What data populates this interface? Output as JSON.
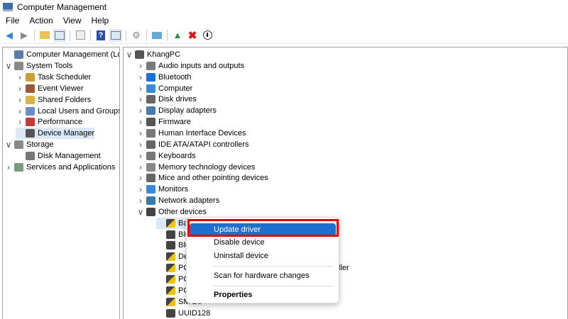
{
  "window": {
    "title": "Computer Management"
  },
  "menu": [
    "File",
    "Action",
    "View",
    "Help"
  ],
  "toolbar": [
    "back-icon",
    "forward-icon",
    "up-folder-icon",
    "show-hide-tree-icon",
    "properties-icon",
    "help-icon",
    "show-action-pane-icon",
    "update-driver-icon",
    "scan-hardware-icon",
    "enable-device-icon",
    "uninstall-icon",
    "disable-device-icon"
  ],
  "left_tree": [
    {
      "label": "Computer Management (Local",
      "level": 0,
      "chev": "",
      "color": "#5a7ea8"
    },
    {
      "label": "System Tools",
      "level": 0,
      "chev": "v",
      "color": "#8a8a8a"
    },
    {
      "label": "Task Scheduler",
      "level": 1,
      "chev": ">",
      "color": "#c9a13b"
    },
    {
      "label": "Event Viewer",
      "level": 1,
      "chev": ">",
      "color": "#9c5a3c"
    },
    {
      "label": "Shared Folders",
      "level": 1,
      "chev": ">",
      "color": "#d9b44a"
    },
    {
      "label": "Local Users and Groups",
      "level": 1,
      "chev": ">",
      "color": "#6b8fc0"
    },
    {
      "label": "Performance",
      "level": 1,
      "chev": ">",
      "color": "#c23b3b"
    },
    {
      "label": "Device Manager",
      "level": 1,
      "chev": "",
      "color": "#555",
      "selected": true
    },
    {
      "label": "Storage",
      "level": 0,
      "chev": "v",
      "color": "#8a8a8a"
    },
    {
      "label": "Disk Management",
      "level": 1,
      "chev": "",
      "color": "#777"
    },
    {
      "label": "Services and Applications",
      "level": 0,
      "chev": ">",
      "color": "#7a9a7a"
    }
  ],
  "device_tree": {
    "root": "KhangPC",
    "categories": [
      "Audio inputs and outputs",
      "Bluetooth",
      "Computer",
      "Disk drives",
      "Display adapters",
      "Firmware",
      "Human Interface Devices",
      "IDE ATA/ATAPI controllers",
      "Keyboards",
      "Memory technology devices",
      "Mice and other pointing devices",
      "Monitors",
      "Network adapters",
      "Other devices"
    ],
    "other_devices": [
      "Base S",
      "Bluet",
      "Bluet",
      "Detec",
      "PCI D",
      "PCI D",
      "PCI S",
      "SM Bu",
      "UUID128"
    ],
    "overflow_fragment": "ller"
  },
  "context_menu": {
    "items": [
      "Update driver",
      "Disable device",
      "Uninstall device",
      "Scan for hardware changes",
      "Properties"
    ],
    "highlight_color": "#1f6fcf",
    "callout_color": "#e00000"
  }
}
